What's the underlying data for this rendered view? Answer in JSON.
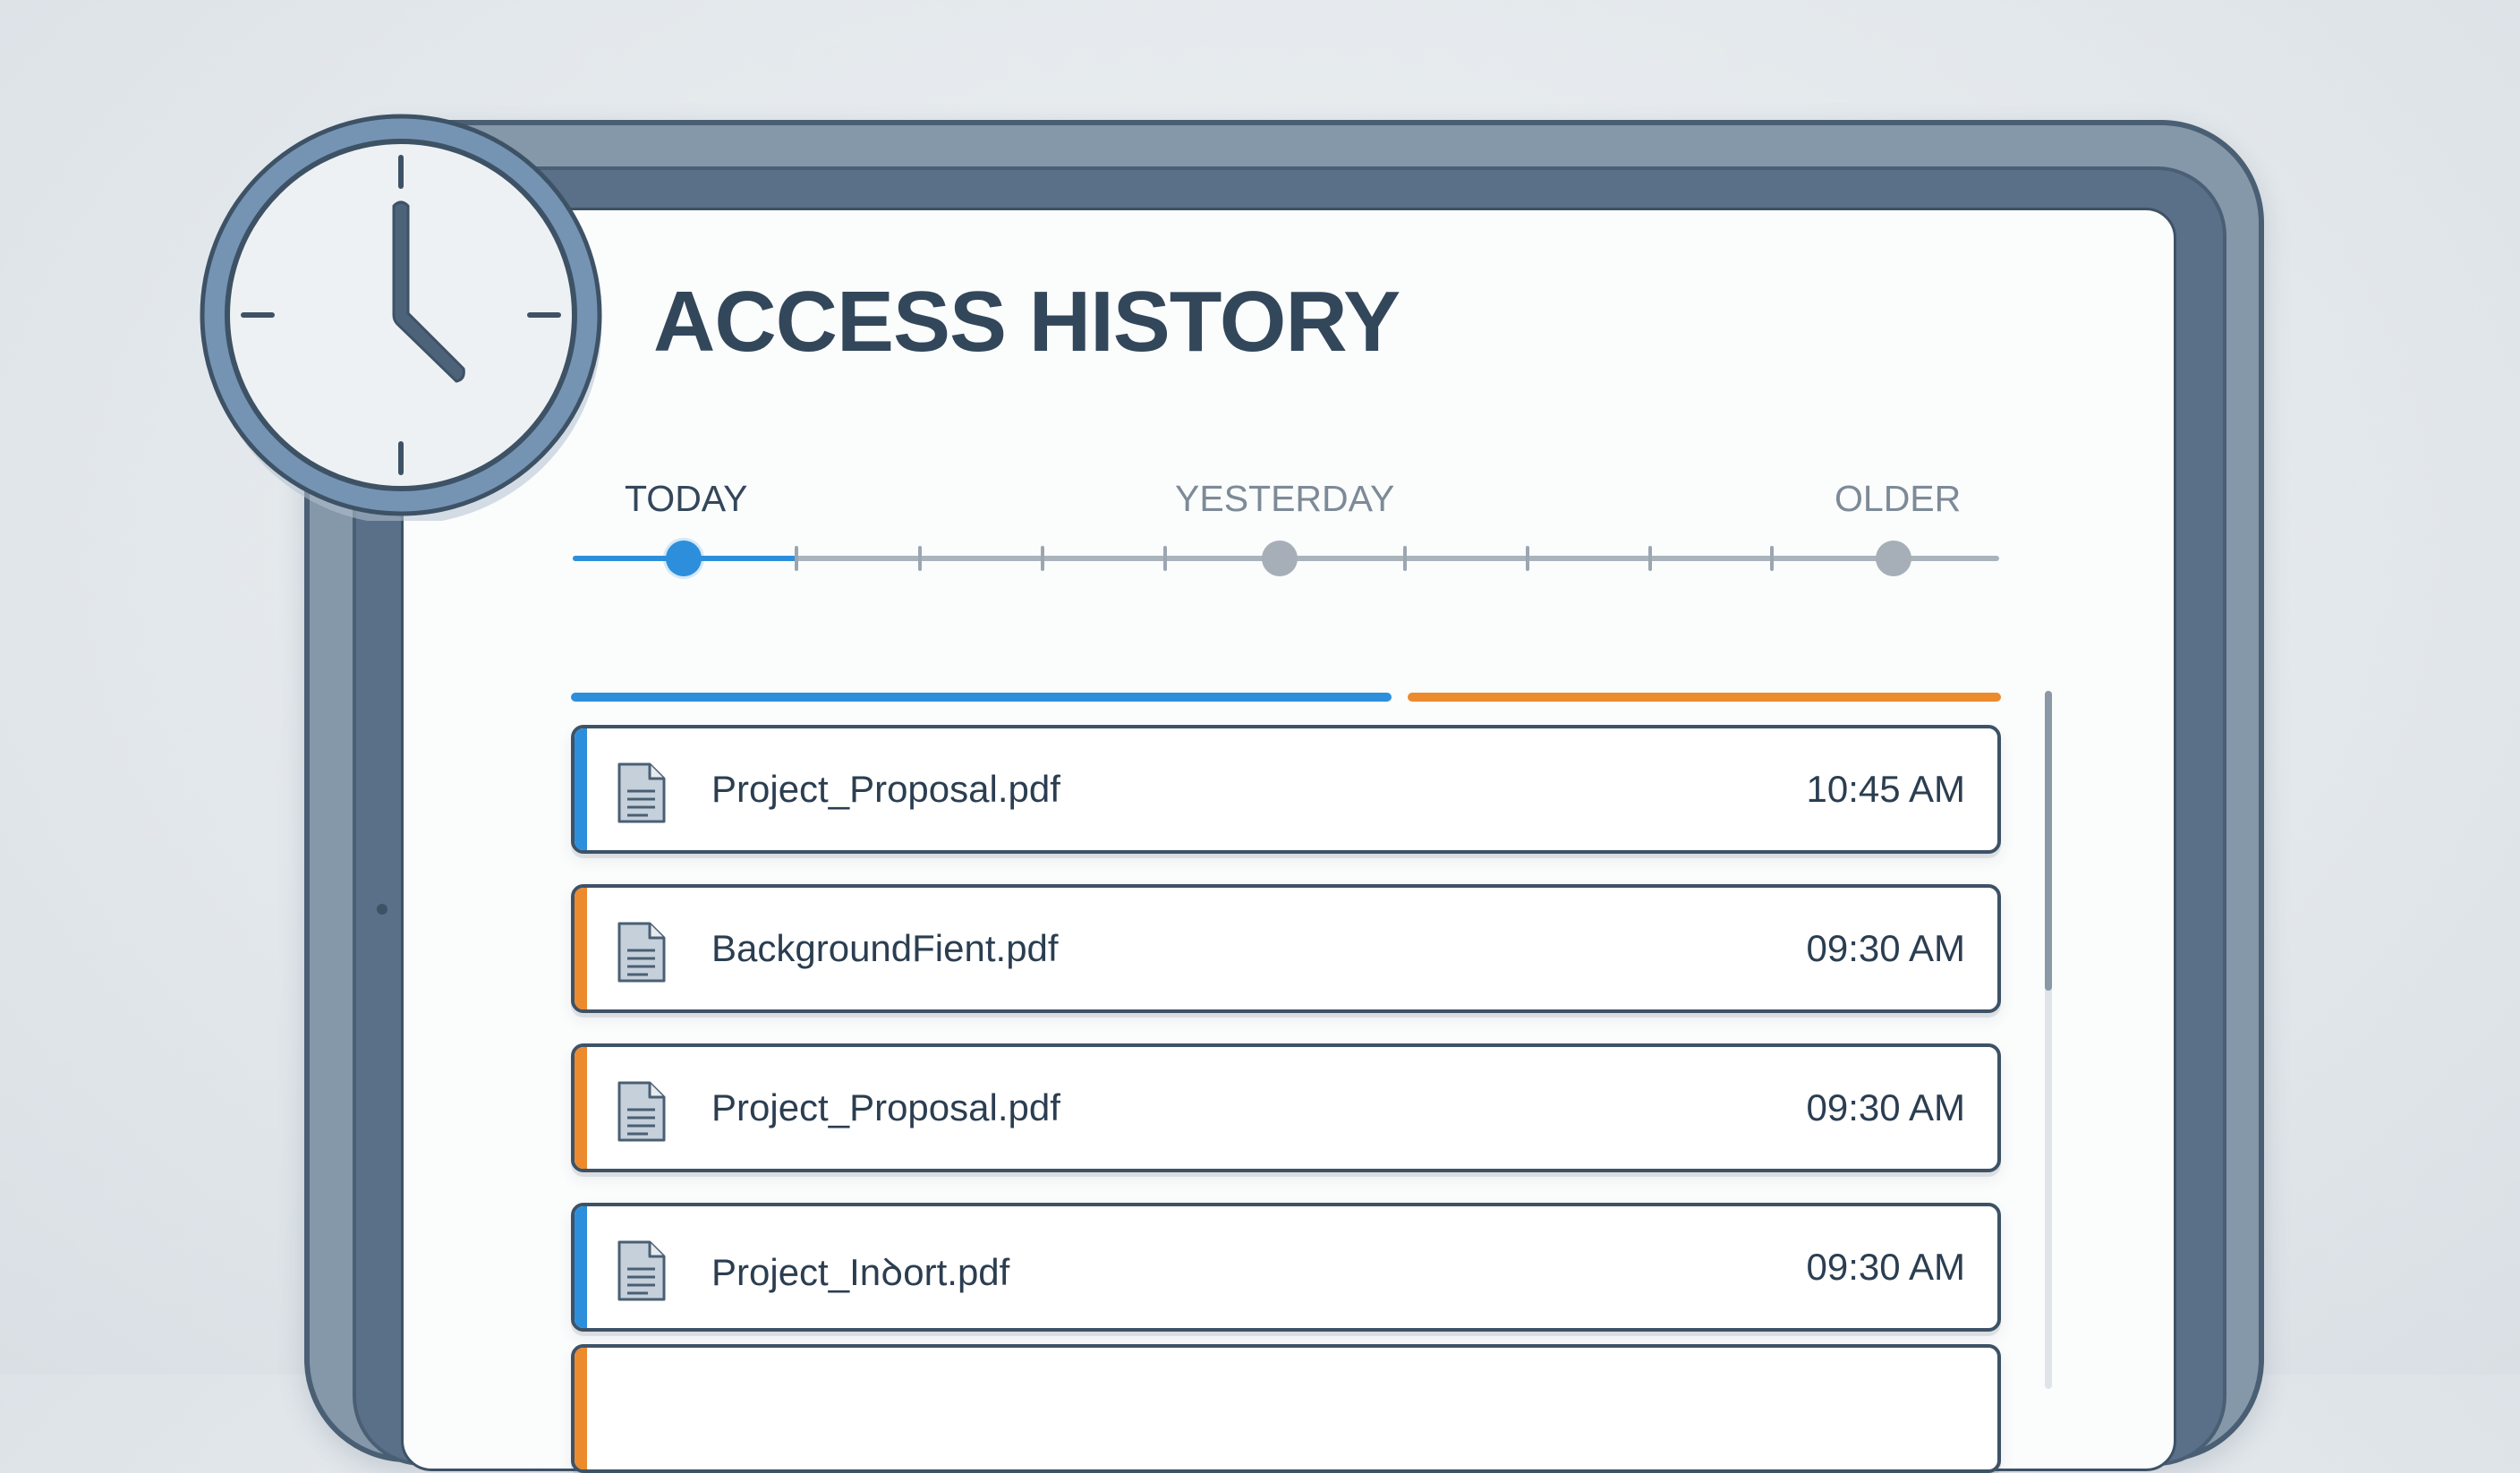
{
  "header": {
    "title": "ACCESS HISTORY"
  },
  "timeline": {
    "labels": [
      {
        "label": "TODAY",
        "active": true
      },
      {
        "label": "YESTERDAY",
        "active": false
      },
      {
        "label": "OLDER",
        "active": false
      }
    ]
  },
  "files": [
    {
      "name": "Project_Proposal.pdf",
      "time": "10:45 AM",
      "accent": "blue",
      "icon": "document-icon"
    },
    {
      "name": "BackgroundFient.pdf",
      "time": "09:30 AM",
      "accent": "orange",
      "icon": "document-icon"
    },
    {
      "name": "Project_Proposal.pdf",
      "time": "09:30 AM",
      "accent": "orange",
      "icon": "document-icon"
    },
    {
      "name": "Project_Inꝺort.pdf",
      "time": "09:30 AM",
      "accent": "blue",
      "icon": "document-icon"
    },
    {
      "name": "",
      "time": "",
      "accent": "orange",
      "icon": "document-icon"
    }
  ],
  "colors": {
    "accent_blue": "#2d8fdc",
    "accent_orange": "#ec8a2e",
    "frame": "#5a7088",
    "text": "#33475b"
  },
  "icons": {
    "badge": "clock-icon",
    "file": "document-icon"
  }
}
